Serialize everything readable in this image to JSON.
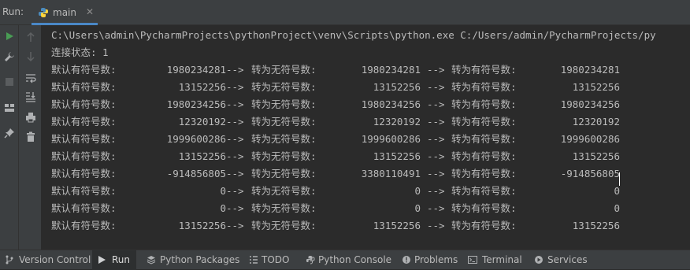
{
  "run_panel": {
    "label": "Run:"
  },
  "tab": {
    "title": "main"
  },
  "console": {
    "command": "C:\\Users\\admin\\PycharmProjects\\pythonProject\\venv\\Scripts\\python.exe C:/Users/admin/PycharmProjects/py",
    "status": "连接状态: 1",
    "label_signed": "默认有符号数:",
    "label_unsigned": "转为无符号数:",
    "label_to_signed": "转为有符号数:",
    "arrow": "-->",
    "rows": [
      {
        "signed": "1980234281",
        "unsigned": "1980234281",
        "resigned": "1980234281"
      },
      {
        "signed": "13152256",
        "unsigned": "13152256",
        "resigned": "13152256"
      },
      {
        "signed": "1980234256",
        "unsigned": "1980234256",
        "resigned": "1980234256"
      },
      {
        "signed": "12320192",
        "unsigned": "12320192",
        "resigned": "12320192"
      },
      {
        "signed": "1999600286",
        "unsigned": "1999600286",
        "resigned": "1999600286"
      },
      {
        "signed": "13152256",
        "unsigned": "13152256",
        "resigned": "13152256"
      },
      {
        "signed": "-914856805",
        "unsigned": "3380110491",
        "resigned": "-914856805"
      },
      {
        "signed": "0",
        "unsigned": "0",
        "resigned": "0"
      },
      {
        "signed": "0",
        "unsigned": "0",
        "resigned": "0"
      },
      {
        "signed": "13152256",
        "unsigned": "13152256",
        "resigned": "13152256"
      }
    ]
  },
  "bottom_bar": {
    "version_control": "Version Control",
    "run": "Run",
    "python_packages": "Python Packages",
    "todo": "TODO",
    "python_console": "Python Console",
    "problems": "Problems",
    "terminal": "Terminal",
    "services": "Services"
  },
  "colors": {
    "accent": "#4a88c7",
    "run_green": "#499c54",
    "console_bg": "#2b2b2b",
    "panel_bg": "#3c3f41"
  }
}
